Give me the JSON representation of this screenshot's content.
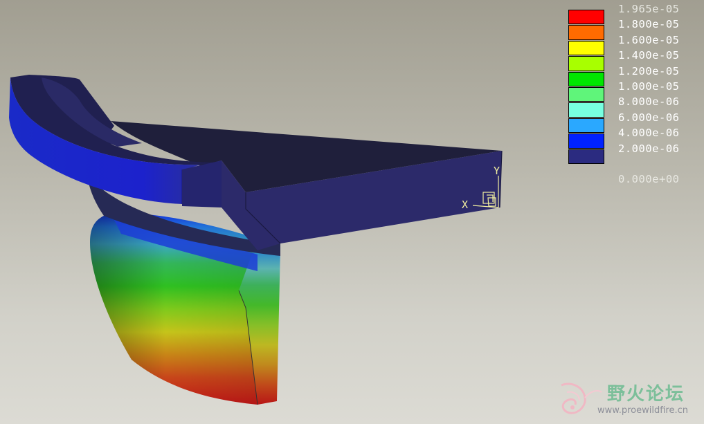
{
  "legend": {
    "items": [
      {
        "label": "1.965e-05",
        "color": "#ff0000"
      },
      {
        "label": "1.800e-05",
        "color": "#ff6b00"
      },
      {
        "label": "1.600e-05",
        "color": "#ffff00"
      },
      {
        "label": "1.400e-05",
        "color": "#a8ff00"
      },
      {
        "label": "1.200e-05",
        "color": "#00e600"
      },
      {
        "label": "1.000e-05",
        "color": "#5ff57a"
      },
      {
        "label": "8.000e-06",
        "color": "#78ffe0"
      },
      {
        "label": "6.000e-06",
        "color": "#2aa8ff"
      },
      {
        "label": "4.000e-06",
        "color": "#0022ff"
      },
      {
        "label": "2.000e-06",
        "color": "#2b2b80"
      }
    ],
    "bottom_label": "0.000e+00"
  },
  "axes": {
    "x_label": "X",
    "y_label": "Y"
  },
  "watermark": {
    "title": "野火论坛",
    "url": "www.proewildfire.cn"
  }
}
